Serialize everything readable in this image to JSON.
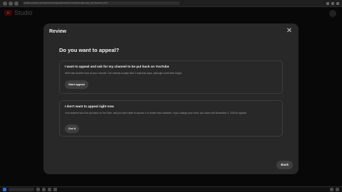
{
  "browser": {
    "url": "studio.youtube.com/channel/UC/appeal/review?c=UC&hl=en&persist_gl=1&persist_hl=1"
  },
  "app": {
    "logo_text": "Studio"
  },
  "dialog": {
    "title": "Review",
    "question": "Do you want to appeal?",
    "option_appeal": {
      "title": "I want to appeal and ask for my channel to be put back on YouTube",
      "description": "We'll take another look at your channel. Our reviews usually take 2 business days, although some take longer.",
      "button": "Start appeal"
    },
    "option_no_appeal": {
      "title": "I don't want to appeal right now",
      "description": "Your channel won't be put back on YouTube, and you won't able to access it or create new channels. If you change your mind, you have until November 3, 2023 to appeal.",
      "button": "Got it"
    },
    "back_button": "Back"
  },
  "colors": {
    "accent": "#ff0000",
    "dialog_bg": "#282828",
    "page_bg": "#0f0f0f"
  }
}
